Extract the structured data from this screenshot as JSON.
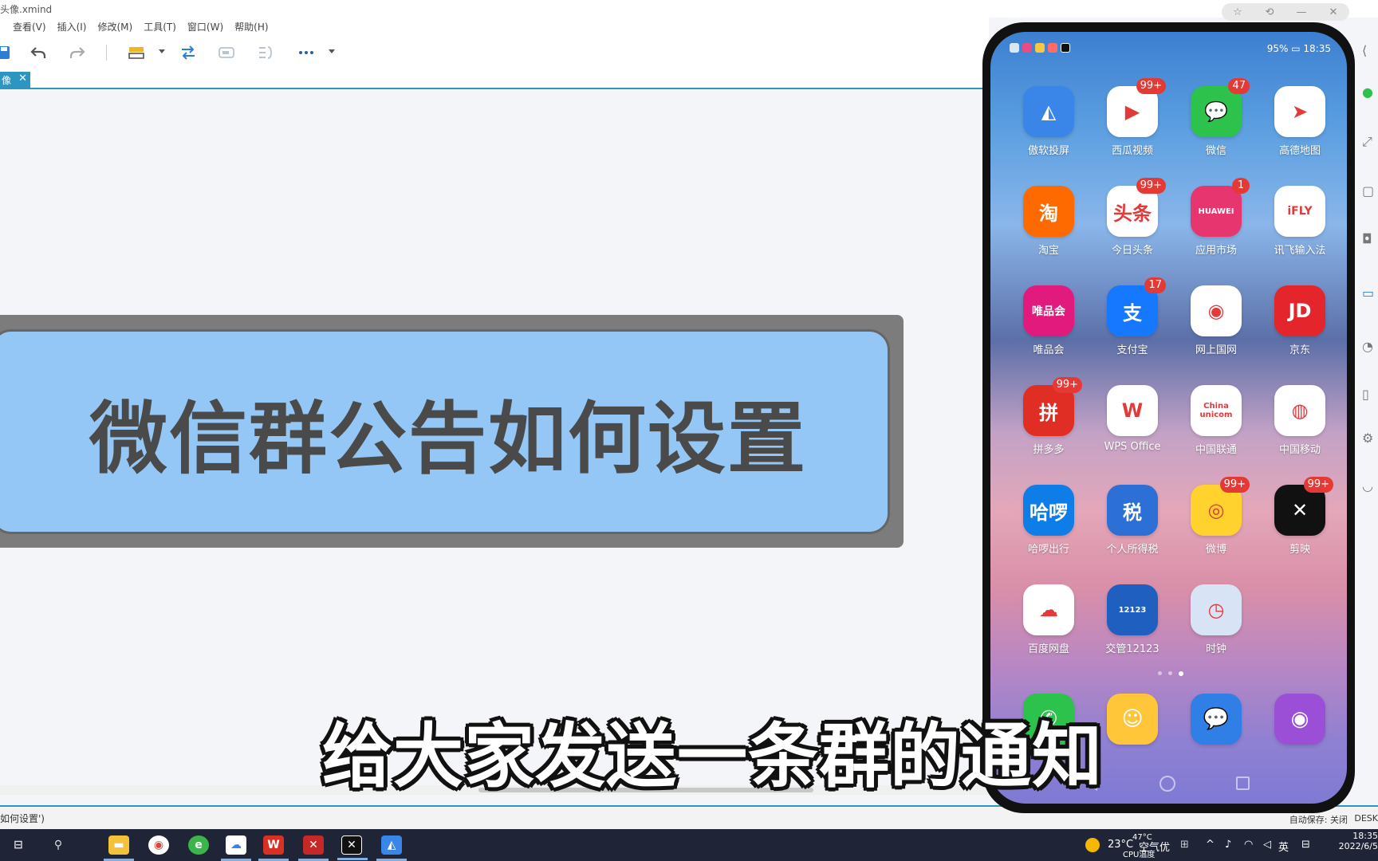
{
  "window": {
    "title": "头像.xmind",
    "controls": [
      "☆",
      "⟲",
      "—",
      "✕"
    ]
  },
  "menu": [
    "查看(V)",
    "插入(I)",
    "修改(M)",
    "工具(T)",
    "窗口(W)",
    "帮助(H)"
  ],
  "tab": {
    "label": "像",
    "close": "✕"
  },
  "topic": {
    "text": "微信群公告如何设置"
  },
  "subtitle": "给大家发送一条群的通知",
  "status": {
    "left": "如何设置')",
    "autosave": "自动保存: 关闭",
    "desk": "DESK"
  },
  "phone": {
    "status_left_icons": [
      "wifi",
      "ai",
      "hd",
      "app",
      "app",
      "capcut"
    ],
    "status_right": "95% ▭ 18:35",
    "apps": [
      {
        "label": "傲软投屏",
        "color": "#3a86e8",
        "glyph": "◭",
        "badge": ""
      },
      {
        "label": "西瓜视频",
        "color": "#ffffff",
        "glyph": "▶",
        "badge": "99+"
      },
      {
        "label": "微信",
        "color": "#2dc24b",
        "glyph": "💬",
        "badge": "47"
      },
      {
        "label": "高德地图",
        "color": "#ffffff",
        "glyph": "➤",
        "badge": ""
      },
      {
        "label": "淘宝",
        "color": "#ff6a00",
        "glyph": "淘",
        "badge": ""
      },
      {
        "label": "今日头条",
        "color": "#ffffff",
        "glyph": "头条",
        "badge": "99+"
      },
      {
        "label": "应用市场",
        "color": "#e7366f",
        "glyph": "HUAWEI",
        "badge": "1"
      },
      {
        "label": "讯飞输入法",
        "color": "#ffffff",
        "glyph": "iFLY",
        "badge": ""
      },
      {
        "label": "唯品会",
        "color": "#e21a7d",
        "glyph": "唯品会",
        "badge": ""
      },
      {
        "label": "支付宝",
        "color": "#1677ff",
        "glyph": "支",
        "badge": "17"
      },
      {
        "label": "网上国网",
        "color": "#ffffff",
        "glyph": "◉",
        "badge": ""
      },
      {
        "label": "京东",
        "color": "#e4252b",
        "glyph": "JD",
        "badge": ""
      },
      {
        "label": "拼多多",
        "color": "#e02e24",
        "glyph": "拼",
        "badge": "99+"
      },
      {
        "label": "WPS Office",
        "color": "#ffffff",
        "glyph": "W",
        "badge": ""
      },
      {
        "label": "中国联通",
        "color": "#ffffff",
        "glyph": "China unicom",
        "badge": ""
      },
      {
        "label": "中国移动",
        "color": "#ffffff",
        "glyph": "◍",
        "badge": ""
      },
      {
        "label": "哈啰出行",
        "color": "#0e7de8",
        "glyph": "哈啰",
        "badge": ""
      },
      {
        "label": "个人所得税",
        "color": "#2c6fd6",
        "glyph": "税",
        "badge": ""
      },
      {
        "label": "微博",
        "color": "#ffd22e",
        "glyph": "◎",
        "badge": "99+"
      },
      {
        "label": "剪映",
        "color": "#111111",
        "glyph": "✕",
        "badge": "99+"
      },
      {
        "label": "百度网盘",
        "color": "#ffffff",
        "glyph": "☁",
        "badge": ""
      },
      {
        "label": "交管12123",
        "color": "#1f5fbf",
        "glyph": "12123",
        "badge": ""
      },
      {
        "label": "时钟",
        "color": "#d8e4f5",
        "glyph": "◷",
        "badge": ""
      }
    ],
    "dock": [
      {
        "name": "phone",
        "color": "#2dc24b",
        "glyph": "✆"
      },
      {
        "name": "contacts",
        "color": "#ffc63a",
        "glyph": "☺"
      },
      {
        "name": "messages",
        "color": "#2f7fe6",
        "glyph": "💬"
      },
      {
        "name": "browser",
        "color": "#9b4fd6",
        "glyph": "◉"
      }
    ]
  },
  "taskbar": {
    "weather_temp": "23°C",
    "weather_text": "空气优",
    "cpu_temp": "47°C",
    "cpu_label": "CPU温度",
    "ime": "英",
    "time": "18:35",
    "date": "2022/6/5"
  }
}
